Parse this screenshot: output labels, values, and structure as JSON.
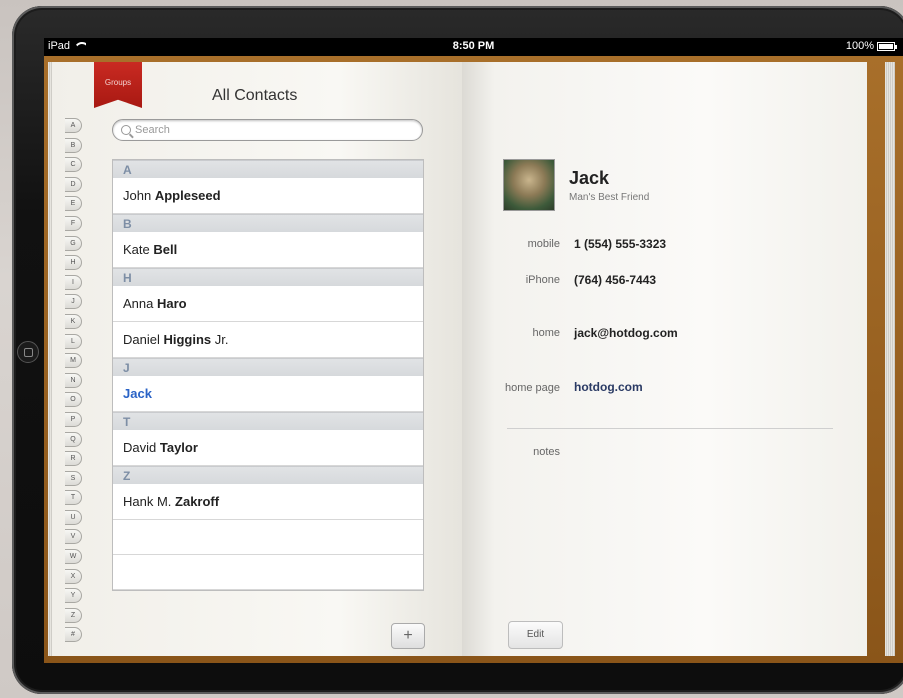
{
  "status_bar": {
    "device": "iPad",
    "time": "8:50 PM",
    "battery": "100%"
  },
  "groups_label": "Groups",
  "title": "All Contacts",
  "search": {
    "placeholder": "Search"
  },
  "index_letters": [
    "A",
    "B",
    "C",
    "D",
    "E",
    "F",
    "G",
    "H",
    "I",
    "J",
    "K",
    "L",
    "M",
    "N",
    "O",
    "P",
    "Q",
    "R",
    "S",
    "T",
    "U",
    "V",
    "W",
    "X",
    "Y",
    "Z",
    "#"
  ],
  "contacts": [
    {
      "section": "A",
      "first": "John",
      "last": "Appleseed",
      "suffix": ""
    },
    {
      "section": "B",
      "first": "Kate",
      "last": "Bell",
      "suffix": ""
    },
    {
      "section": "H",
      "first": "Anna",
      "last": "Haro",
      "suffix": ""
    },
    {
      "section": "",
      "first": "Daniel",
      "last": "Higgins",
      "suffix": " Jr."
    },
    {
      "section": "J",
      "first": "",
      "last": "Jack",
      "suffix": ""
    },
    {
      "section": "T",
      "first": "David",
      "last": "Taylor",
      "suffix": ""
    },
    {
      "section": "Z",
      "first": "Hank M.",
      "last": "Zakroff",
      "suffix": ""
    }
  ],
  "add_label": "+",
  "detail": {
    "name": "Jack",
    "subtitle": "Man's Best Friend",
    "fields": [
      {
        "label": "mobile",
        "value": "1 (554) 555-3323"
      },
      {
        "label": "iPhone",
        "value": "(764) 456-7443"
      },
      {
        "label": "home",
        "value": "jack@hotdog.com"
      },
      {
        "label": "home page",
        "value": "hotdog.com"
      }
    ],
    "notes_label": "notes",
    "edit_label": "Edit"
  },
  "colors": {
    "accent": "#2a63c6",
    "ribbon": "#c92a22",
    "leather": "#a86f2a"
  }
}
